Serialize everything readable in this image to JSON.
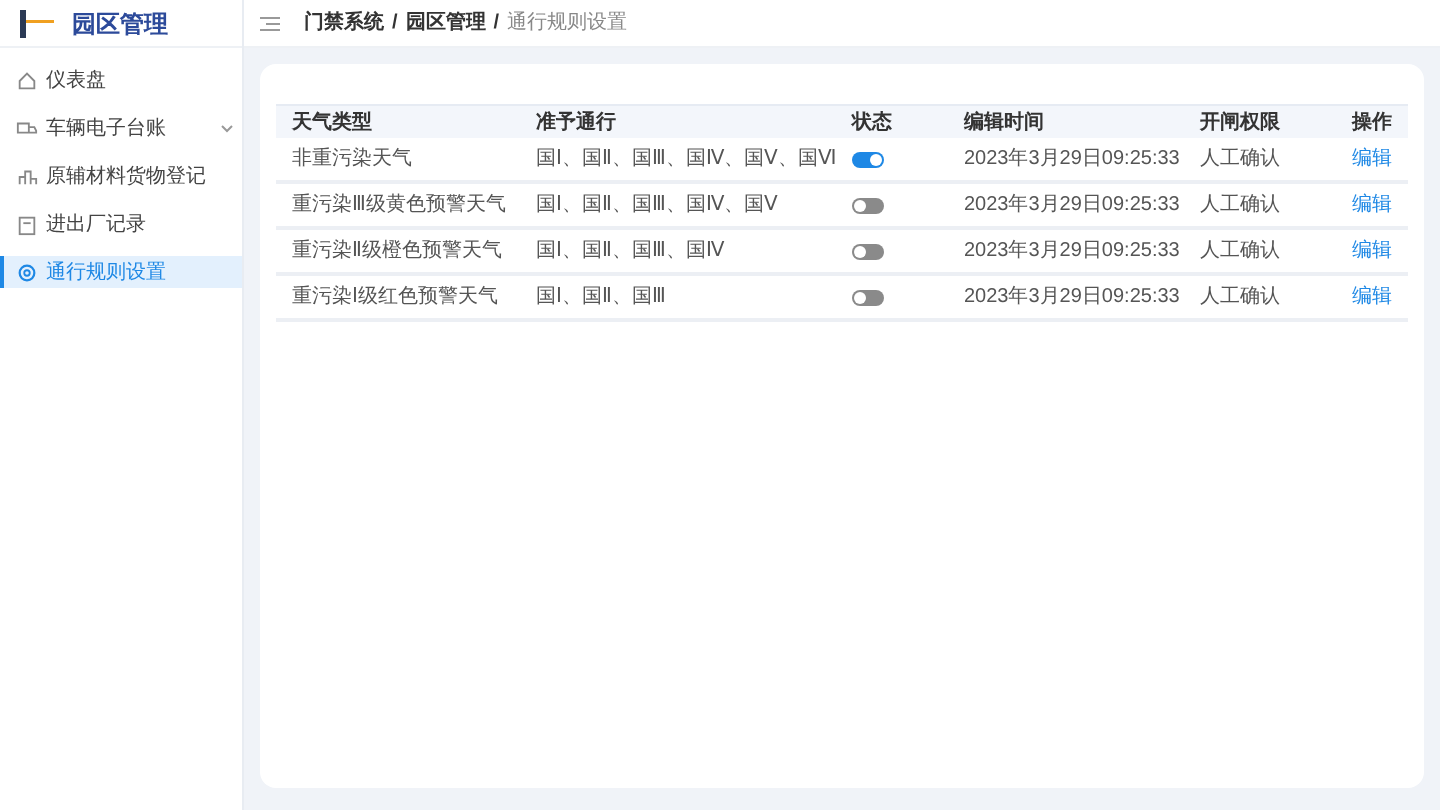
{
  "app": {
    "title": "园区管理"
  },
  "sidebar": {
    "items": [
      {
        "label": "仪表盘",
        "selected": false,
        "expandable": false
      },
      {
        "label": "车辆电子台账",
        "selected": false,
        "expandable": true
      },
      {
        "label": "原辅材料货物登记",
        "selected": false,
        "expandable": false
      },
      {
        "label": "进出厂记录",
        "selected": false,
        "expandable": false
      },
      {
        "label": "通行规则设置",
        "selected": true,
        "expandable": false
      }
    ]
  },
  "breadcrumb": [
    {
      "label": "门禁系统",
      "separator": "/"
    },
    {
      "label": "园区管理",
      "separator": "/"
    },
    {
      "label": "通行规则设置"
    }
  ],
  "table": {
    "columns": [
      "天气类型",
      "准予通行",
      "状态",
      "编辑时间",
      "开闸权限",
      "操作"
    ],
    "rows": [
      {
        "weather": "非重污染天气",
        "allowed": "国Ⅰ、国Ⅱ、国Ⅲ、国Ⅳ、国Ⅴ、国Ⅵ",
        "on": true,
        "time": "2023年3月29日09:25:33",
        "permission": "人工确认",
        "action": "编辑"
      },
      {
        "weather": "重污染Ⅲ级黄色预警天气",
        "allowed": "国Ⅰ、国Ⅱ、国Ⅲ、国Ⅳ、国Ⅴ",
        "on": false,
        "time": "2023年3月29日09:25:33",
        "permission": "人工确认",
        "action": "编辑"
      },
      {
        "weather": "重污染Ⅱ级橙色预警天气",
        "allowed": "国Ⅰ、国Ⅱ、国Ⅲ、国Ⅳ",
        "on": false,
        "time": "2023年3月29日09:25:33",
        "permission": "人工确认",
        "action": "编辑"
      },
      {
        "weather": "重污染Ⅰ级红色预警天气",
        "allowed": "国Ⅰ、国Ⅱ、国Ⅲ",
        "on": false,
        "time": "2023年3月29日09:25:33",
        "permission": "人工确认",
        "action": "编辑"
      }
    ]
  }
}
